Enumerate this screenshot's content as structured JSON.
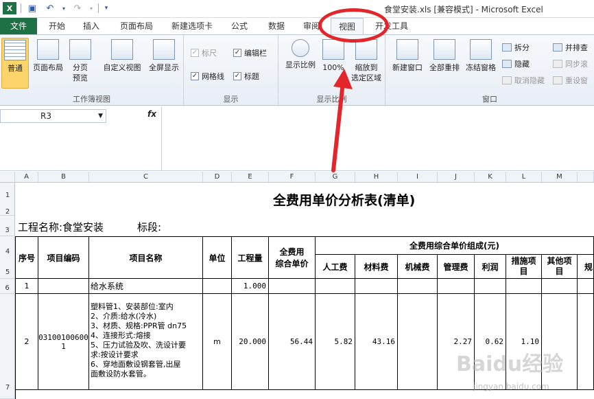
{
  "window": {
    "title": "食堂安装.xls  [兼容模式] - Microsoft Excel"
  },
  "tabs": [
    {
      "label": "文件"
    },
    {
      "label": "开始"
    },
    {
      "label": "插入"
    },
    {
      "label": "页面布局"
    },
    {
      "label": "新建选项卡"
    },
    {
      "label": "公式"
    },
    {
      "label": "数据"
    },
    {
      "label": "审阅"
    },
    {
      "label": "视图"
    },
    {
      "label": "开发工具"
    }
  ],
  "ribbon": {
    "groups": {
      "workbook_views": "工作簿视图",
      "show": "显示",
      "zoom": "显示比例",
      "window": "窗口"
    },
    "buttons": {
      "normal": "普通",
      "page_layout": "页面布局",
      "page_break_1": "分页",
      "page_break_2": "预览",
      "custom_view": "自定义视图",
      "full_screen": "全屏显示",
      "ruler": "标尺",
      "formula_bar": "编辑栏",
      "gridlines": "网格线",
      "headings": "标题",
      "zoom": "显示比例",
      "zoom100": "100%",
      "zoom_sel_1": "缩放到",
      "zoom_sel_2": "选定区域",
      "new_window": "新建窗口",
      "arrange_all": "全部重排",
      "freeze_panes": "冻结窗格",
      "split": "拆分",
      "hide": "隐藏",
      "unhide": "取消隐藏",
      "side_by_side": "并排查",
      "sync_scroll": "同步滚",
      "reset_pos": "重设窗"
    }
  },
  "formula_bar": {
    "name_box": "R3",
    "fx": "fx"
  },
  "columns": [
    "A",
    "B",
    "C",
    "D",
    "E",
    "F",
    "G",
    "H",
    "I",
    "J",
    "K",
    "L",
    "M"
  ],
  "rows": [
    "1",
    "2",
    "3",
    "4",
    "5",
    "6",
    "7"
  ],
  "sheet": {
    "title": "全费用单价分析表(清单)",
    "project": "工程名称:食堂安装",
    "section": "标段:",
    "headers": {
      "seq": "序号",
      "code": "项目编码",
      "name": "项目名称",
      "unit": "单位",
      "qty": "工程量",
      "total_1": "全费用",
      "total_2": "综合单价",
      "composition": "全费用综合单价组成(元)",
      "labor": "人工费",
      "material": "材料费",
      "machine": "机械费",
      "mgmt": "管理费",
      "profit": "利润",
      "measure_1": "措施项",
      "measure_2": "目",
      "other_1": "其他项",
      "other_2": "目",
      "regul": "规"
    },
    "row6": {
      "seq": "1",
      "name": "给水系统",
      "qty": "1.000"
    },
    "row7": {
      "seq": "2",
      "code_1": "03100100600",
      "code_2": "1",
      "name_lines": [
        "塑料管1、安装部位:室内",
        "2、介质:给水(冷水)",
        "3、材质、规格:PPR管 dn75",
        "4、连接形式:熔接",
        "5、压力试验及吹、洗设计要",
        "求:按设计要求",
        "6、穿地面敷设钢套管,出屋",
        "面敷设防水套管。"
      ],
      "unit": "m",
      "qty": "20.000",
      "total": "56.44",
      "labor": "5.82",
      "material": "43.16",
      "mgmt": "2.27",
      "profit": "0.62",
      "measure": "1.10"
    }
  },
  "watermark": {
    "brand": "Baidu经验",
    "url": "jingyan.baidu.com"
  },
  "colors": {
    "file_tab": "#1e7145",
    "annotation": "#e3262b",
    "selected": "#fbd56b"
  }
}
